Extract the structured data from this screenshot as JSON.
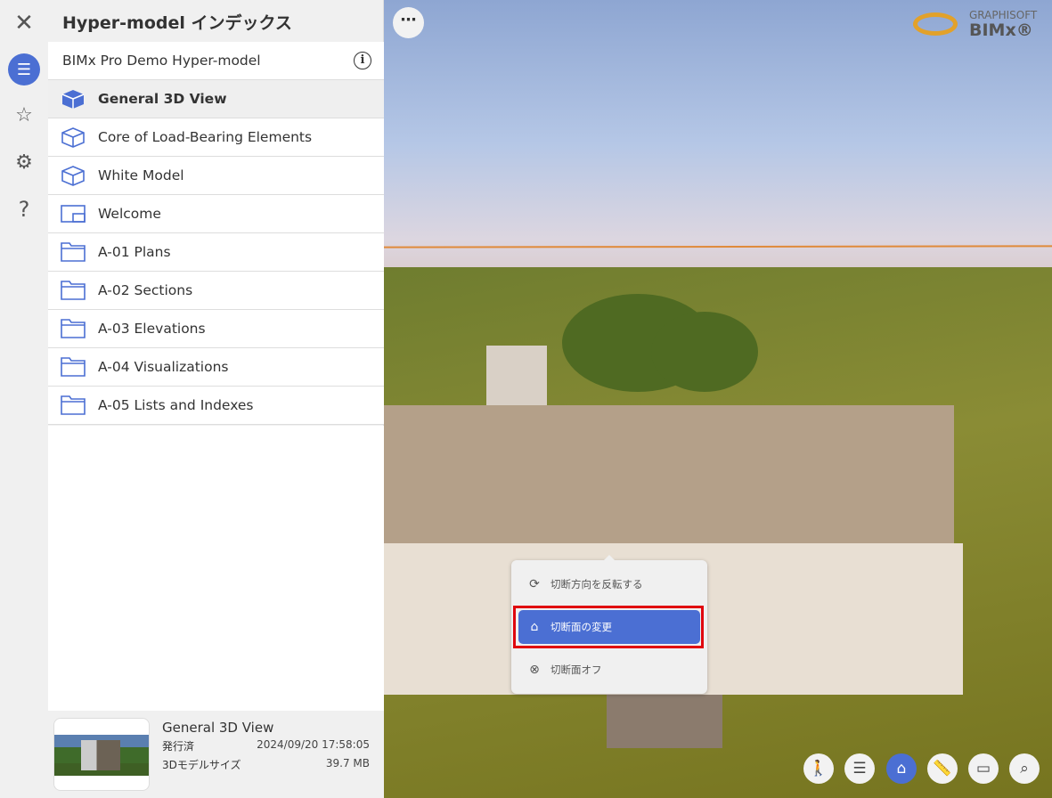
{
  "panel": {
    "title": "Hyper-model インデックス",
    "project": "BIMx Pro Demo Hyper-model",
    "items": [
      {
        "label": "General 3D View",
        "icon": "cube-filled-icon",
        "selected": true
      },
      {
        "label": "Core of Load-Bearing Elements",
        "icon": "cube-icon"
      },
      {
        "label": "White Model",
        "icon": "cube-icon"
      },
      {
        "label": "Welcome",
        "icon": "layout-icon"
      },
      {
        "label": "A-01 Plans",
        "icon": "folder-icon"
      },
      {
        "label": "A-02 Sections",
        "icon": "folder-icon"
      },
      {
        "label": "A-03 Elevations",
        "icon": "folder-icon"
      },
      {
        "label": "A-04 Visualizations",
        "icon": "folder-icon"
      },
      {
        "label": "A-05 Lists and Indexes",
        "icon": "folder-icon"
      }
    ]
  },
  "card": {
    "title": "General 3D View",
    "published_label": "発行済",
    "published_value": "2024/09/20 17:58:05",
    "size_label": "3Dモデルサイズ",
    "size_value": "39.7 MB"
  },
  "logo": {
    "top": "GRAPHISOFT",
    "main": "BIMx®"
  },
  "menu": {
    "items": [
      "切断方向を反転する",
      "切断面の変更",
      "切断面オフ"
    ]
  },
  "colors": {
    "accent": "#4b6fd3",
    "highlight": "#e0060e"
  }
}
